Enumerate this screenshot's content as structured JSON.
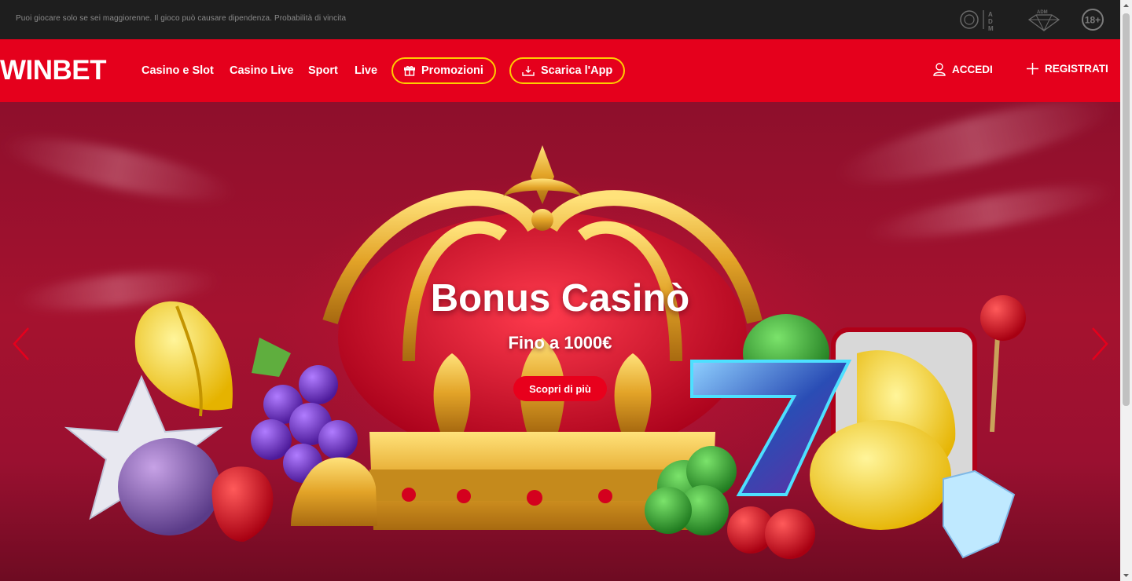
{
  "topbar": {
    "disclaimer": "Puoi giocare solo se sei maggiorenne. Il gioco può causare dipendenza. Probabilità di vincita",
    "logo_adm_label": "ADM",
    "age_label": "18+"
  },
  "nav": {
    "brand": "WINBET",
    "links": [
      "Casino e Slot",
      "Casino Live",
      "Sport",
      "Live"
    ],
    "promo_label": "Promozioni",
    "app_label": "Scarica l'App",
    "login_label": "ACCEDI",
    "register_label": "REGISTRATI"
  },
  "hero": {
    "title": "Bonus Casinò",
    "subtitle": "Fino a 1000€",
    "cta_label": "Scopri di più"
  },
  "colors": {
    "brand_red": "#e5001c",
    "pill_border": "#ffcc00",
    "topbar_bg": "#1e1e1e",
    "hero_bg": "#a5122f"
  },
  "icons": {
    "promo": "gift-icon",
    "app": "download-icon",
    "login": "user-icon",
    "register": "plus-icon",
    "prev": "chevron-left-icon",
    "next": "chevron-right-icon"
  }
}
